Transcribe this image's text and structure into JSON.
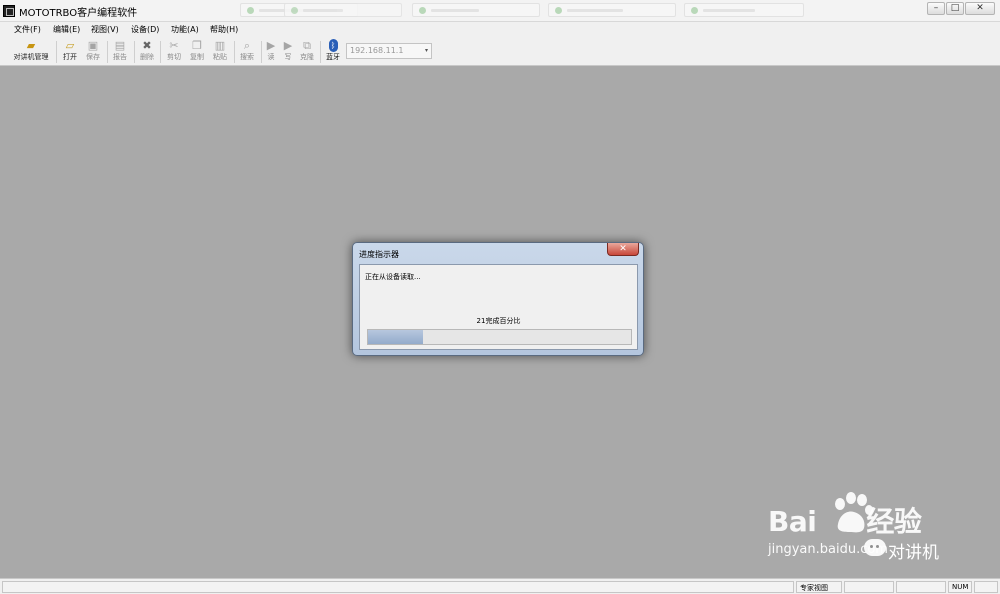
{
  "window": {
    "title": "MOTOTRBO客户编程软件",
    "minimize_glyph": "–",
    "maximize_glyph": "□",
    "close_glyph": "✕"
  },
  "menu": [
    {
      "label": "文件(F)"
    },
    {
      "label": "编辑(E)"
    },
    {
      "label": "视图(V)"
    },
    {
      "label": "设备(D)"
    },
    {
      "label": "功能(A)"
    },
    {
      "label": "帮助(H)"
    }
  ],
  "toolbar": {
    "radio_manage": {
      "label": "对讲机管理",
      "icon": "radio-manage-icon"
    },
    "open": {
      "label": "打开",
      "icon": "folder-open-icon"
    },
    "save": {
      "label": "保存",
      "icon": "save-icon"
    },
    "report": {
      "label": "报告",
      "icon": "report-icon"
    },
    "delete": {
      "label": "删除",
      "icon": "delete-icon"
    },
    "cut": {
      "label": "剪切",
      "icon": "cut-icon"
    },
    "copy": {
      "label": "复制",
      "icon": "copy-icon"
    },
    "paste": {
      "label": "粘贴",
      "icon": "paste-icon"
    },
    "search": {
      "label": "搜索",
      "icon": "search-icon"
    },
    "read": {
      "label": "读",
      "icon": "read-icon"
    },
    "write": {
      "label": "写",
      "icon": "write-icon"
    },
    "clone": {
      "label": "克隆",
      "icon": "clone-icon"
    },
    "bluetooth": {
      "label": "蓝牙",
      "icon": "bluetooth-icon"
    },
    "ip_address": "192.168.11.1"
  },
  "dialog": {
    "title": "进度指示器",
    "close_glyph": "✕",
    "status": "正在从设备读取...",
    "percent_text": "21完成百分比",
    "progress_value": 0.21,
    "progress_color": "#a6bbd7"
  },
  "statusbar": {
    "view_mode": "专家视图",
    "num_lock": "NUM"
  },
  "watermark": {
    "brand": "Bai",
    "brand_suffix": "经验",
    "site": "jingyan.baidu.com",
    "account": "对讲机"
  }
}
